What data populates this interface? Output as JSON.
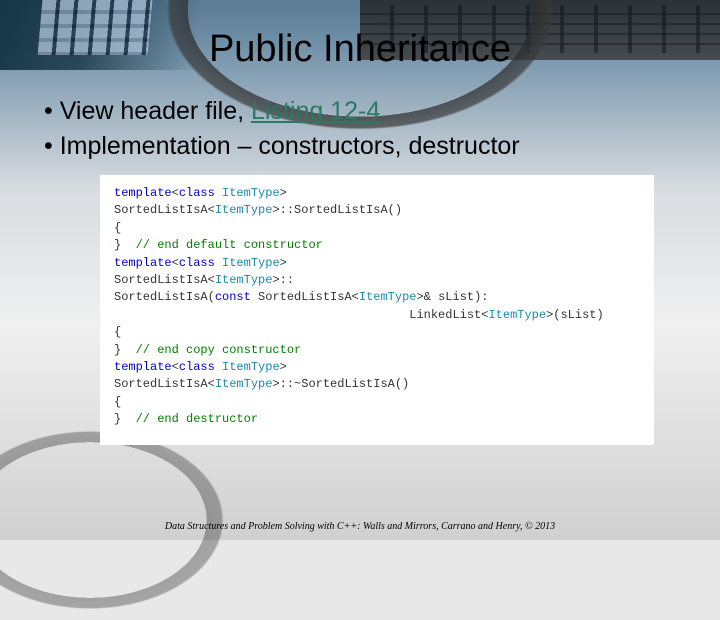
{
  "title": "Public Inheritance",
  "bullets": {
    "b1_prefix": "View header file, ",
    "b1_link": "Listing 12-4",
    "b2": "Implementation – constructors, destructor"
  },
  "code": {
    "l1a": "template",
    "l1b": "<",
    "l1c": "class",
    "l1d": " ItemType",
    "l1e": ">",
    "l2a": "SortedListIsA<",
    "l2b": "ItemType",
    "l2c": ">::SortedListIsA()",
    "l3": "{",
    "l4a": "}  ",
    "l4b": "// end default constructor",
    "l5": "",
    "l6a": "template",
    "l6b": "<",
    "l6c": "class",
    "l6d": " ItemType",
    "l6e": ">",
    "l7a": "SortedListIsA<",
    "l7b": "ItemType",
    "l7c": ">::",
    "l8a": "SortedListIsA(",
    "l8b": "const",
    "l8c": " SortedListIsA<",
    "l8d": "ItemType",
    "l8e": ">& sList):",
    "l9a": "                                         LinkedList<",
    "l9b": "ItemType",
    "l9c": ">(sList)",
    "l10": "{",
    "l11a": "}  ",
    "l11b": "// end copy constructor",
    "l12": "",
    "l13a": "template",
    "l13b": "<",
    "l13c": "class",
    "l13d": " ItemType",
    "l13e": ">",
    "l14": "",
    "l15a": "SortedListIsA<",
    "l15b": "ItemType",
    "l15c": ">::~SortedListIsA()",
    "l16": "{",
    "l17a": "}  ",
    "l17b": "// end destructor"
  },
  "footer": "Data Structures and Problem Solving with C++: Walls and Mirrors, Carrano and Henry, ©  2013"
}
